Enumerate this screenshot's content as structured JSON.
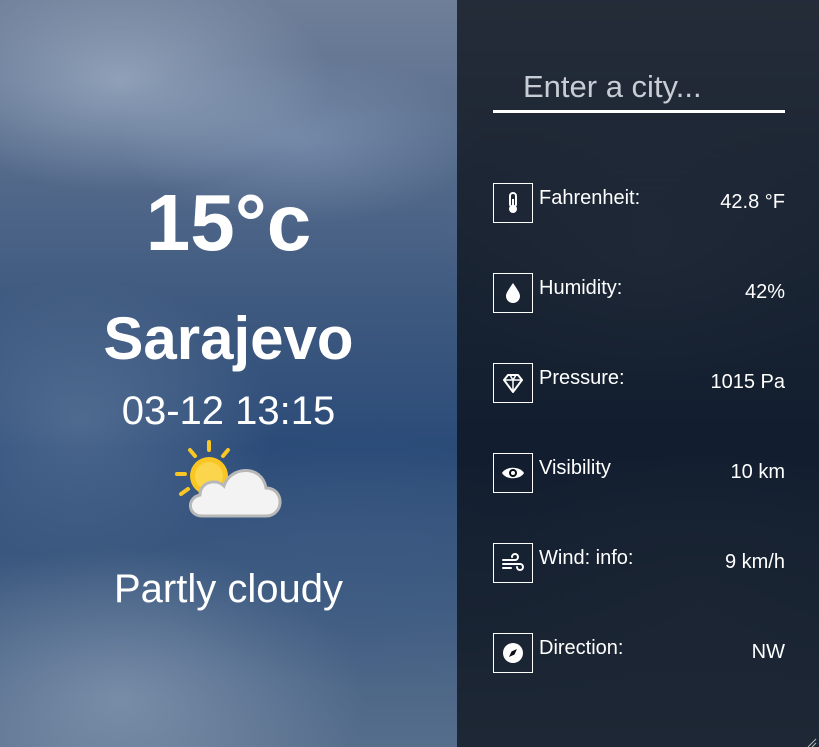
{
  "weather": {
    "temperature": "15°c",
    "city": "Sarajevo",
    "datetime": "03-12 13:15",
    "condition": "Partly cloudy",
    "condition_icon": "partly-cloudy-icon"
  },
  "search": {
    "placeholder": "Enter a city..."
  },
  "details": [
    {
      "label": "Fahrenheit:",
      "value": "42.8 °F",
      "icon": "thermometer-icon"
    },
    {
      "label": "Humidity:",
      "value": "42%",
      "icon": "droplet-icon"
    },
    {
      "label": "Pressure:",
      "value": "1015 Pa",
      "icon": "gem-icon"
    },
    {
      "label": "Visibility",
      "value": "10 km",
      "icon": "eye-icon"
    },
    {
      "label": "Wind: info:",
      "value": "9 km/h",
      "icon": "wind-icon"
    },
    {
      "label": "Direction:",
      "value": "NW",
      "icon": "compass-icon"
    }
  ],
  "colors": {
    "sun": "#f9c623",
    "cloud": "#f2f2f2",
    "panel_overlay": "#080c14"
  }
}
